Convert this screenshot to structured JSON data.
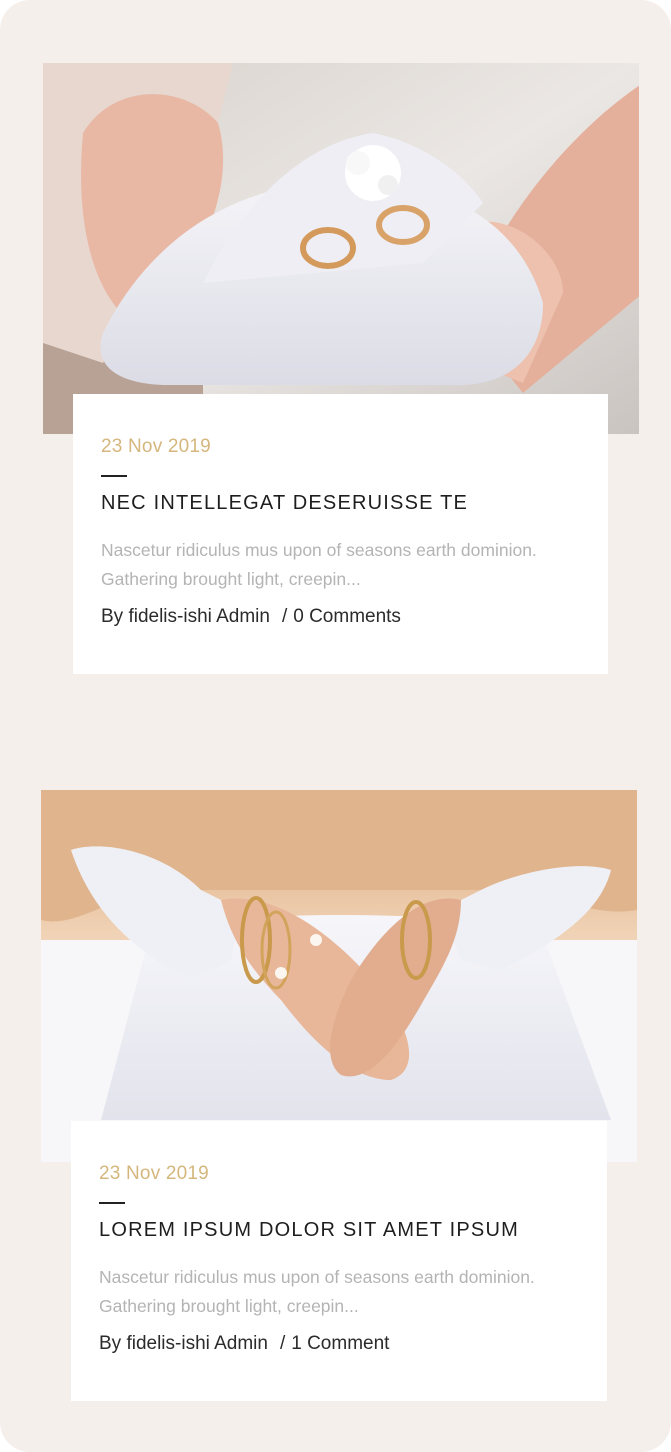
{
  "posts": [
    {
      "image": "wedding-rings-on-pillow",
      "date": "23 Nov 2019",
      "title": "NEC INTELLEGAT DESERUISSE TE",
      "excerpt": "Nascetur ridiculus mus upon of seasons earth dominion. Gathering brought light, creepin...",
      "author": "By fidelis-ishi Admin",
      "separator": "/",
      "comments": "0 Comments"
    },
    {
      "image": "hands-with-bracelets",
      "date": "23 Nov 2019",
      "title": "LOREM IPSUM DOLOR SIT AMET IPSUM",
      "excerpt": "Nascetur ridiculus mus upon of seasons earth dominion. Gathering brought light, creepin...",
      "author": "By fidelis-ishi Admin",
      "separator": "/",
      "comments": "1 Comment"
    }
  ],
  "colors": {
    "background": "#f5efec",
    "card": "#ffffff",
    "date": "#d5b77e",
    "title": "#1e1e1e",
    "excerpt": "#b4b4b4",
    "meta": "#2b2b2b"
  }
}
